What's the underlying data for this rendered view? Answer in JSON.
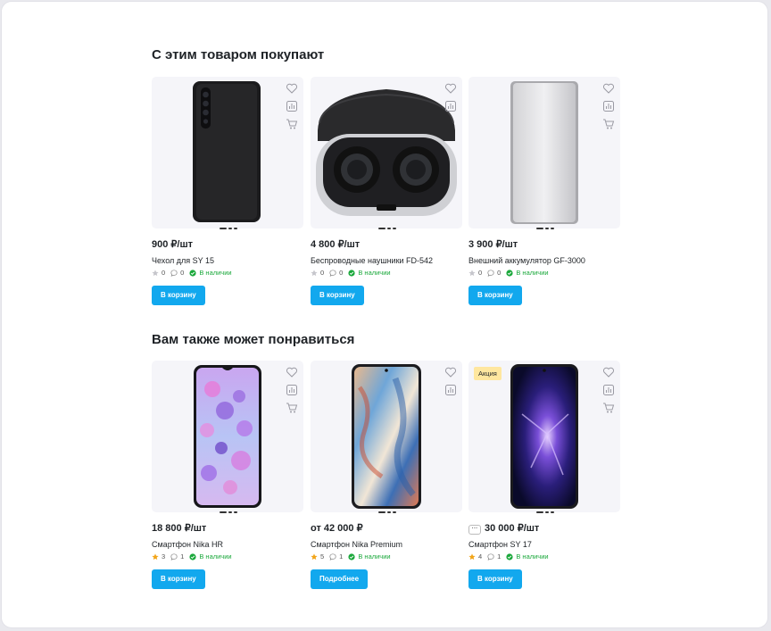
{
  "section1": {
    "title": "С этим товаром покупают",
    "products": [
      {
        "price": "900 ₽/шт",
        "name": "Чехол для SY 15",
        "rating": "0",
        "reviews": "0",
        "stock": "В наличии",
        "button": "В корзину",
        "image": "phone-case"
      },
      {
        "price": "4 800 ₽/шт",
        "name": "Беспроводные наушники FD-542",
        "rating": "0",
        "reviews": "0",
        "stock": "В наличии",
        "button": "В корзину",
        "image": "earbuds"
      },
      {
        "price": "3 900 ₽/шт",
        "name": "Внешний аккумулятор GF-3000",
        "rating": "0",
        "reviews": "0",
        "stock": "В наличии",
        "button": "В корзину",
        "image": "power-bank"
      }
    ]
  },
  "section2": {
    "title": "Вам также может понравиться",
    "products": [
      {
        "price": "18 800 ₽/шт",
        "name": "Смартфон Nika HR",
        "rating": "3",
        "reviews": "1",
        "stock": "В наличии",
        "button": "В корзину",
        "image": "phone-bubbles"
      },
      {
        "price": "от 42 000 ₽",
        "name": "Смартфон Nika Premium",
        "rating": "5",
        "reviews": "1",
        "stock": "В наличии",
        "button": "Подробнее",
        "image": "phone-paint"
      },
      {
        "price": "30 000 ₽/шт",
        "more_icon": "ellipsis-icon",
        "name": "Смартфон SY 17",
        "rating": "4",
        "reviews": "1",
        "stock": "В наличии",
        "button": "В корзину",
        "badge": "Акция",
        "image": "phone-galaxy"
      }
    ]
  },
  "colors": {
    "accent": "#12a8ee",
    "stock": "#1aa83b",
    "star_active": "#f2a51a",
    "star_inactive": "#c6c6cc",
    "badge": "#ffe79f",
    "card_bg": "#f5f5f9"
  }
}
